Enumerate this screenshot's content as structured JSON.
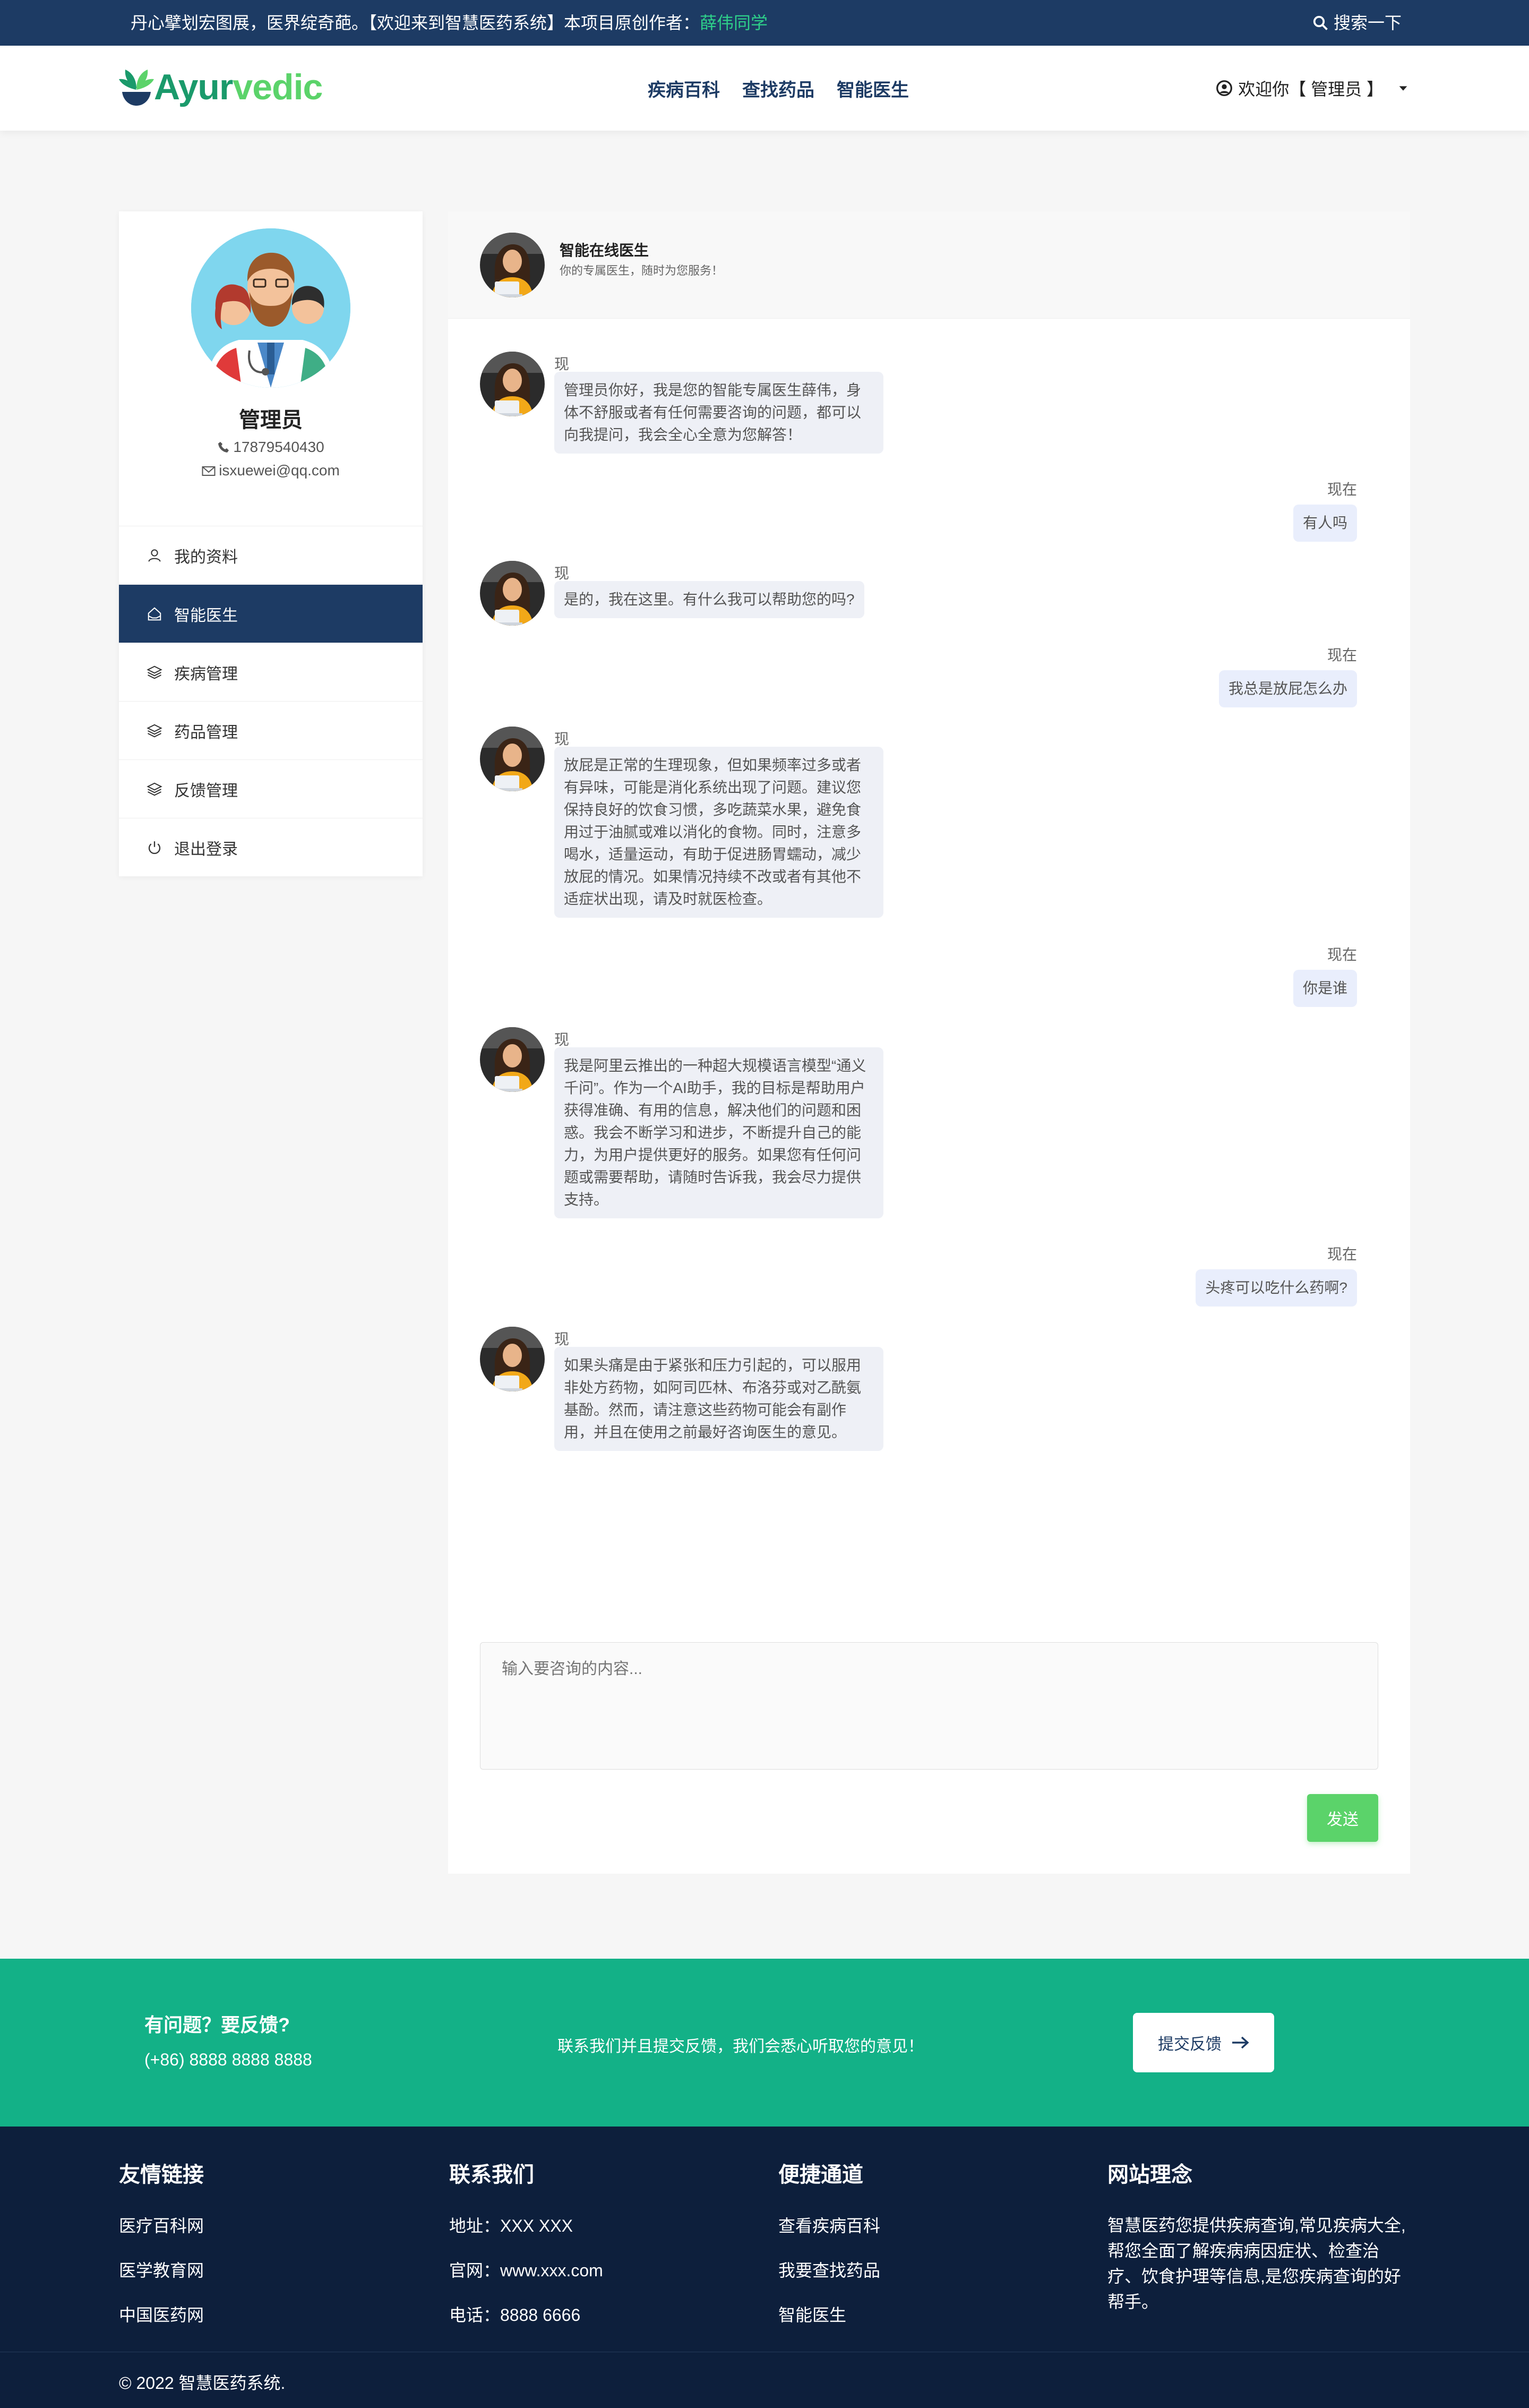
{
  "topbar": {
    "message": "丹心擘划宏图展，医界绽奇葩。【欢迎来到智慧医药系统】本项目原创作者：",
    "author": "薛伟同学",
    "search_label": "搜索一下"
  },
  "nav": {
    "logo_a": "Ayur",
    "logo_b": "vedic",
    "links": [
      "疾病百科",
      "查找药品",
      "智能医生"
    ],
    "user_label": "欢迎你【 管理员 】"
  },
  "profile": {
    "name": "管理员",
    "phone": "17879540430",
    "email": "isxuewei@qq.com"
  },
  "menu": [
    {
      "label": "我的资料",
      "icon": "user-icon"
    },
    {
      "label": "智能医生",
      "icon": "home-icon"
    },
    {
      "label": "疾病管理",
      "icon": "layers-icon"
    },
    {
      "label": "药品管理",
      "icon": "layers-icon"
    },
    {
      "label": "反馈管理",
      "icon": "layers-icon"
    },
    {
      "label": "退出登录",
      "icon": "power-icon"
    }
  ],
  "chat": {
    "title": "智能在线医生",
    "subtitle": "你的专属医生，随时为您服务！",
    "messages": [
      {
        "side": "left",
        "time": "现在",
        "text": "管理员你好，我是您的智能专属医生薛伟，身体不舒服或者有任何需要咨询的问题，都可以向我提问，我会全心全意为您解答！"
      },
      {
        "side": "right",
        "time": "现在",
        "text": "有人吗"
      },
      {
        "side": "left",
        "time": "现在",
        "text": "是的，我在这里。有什么我可以帮助您的吗?"
      },
      {
        "side": "right",
        "time": "现在",
        "text": "我总是放屁怎么办"
      },
      {
        "side": "left",
        "time": "现在",
        "text": "放屁是正常的生理现象，但如果频率过多或者有异味，可能是消化系统出现了问题。建议您保持良好的饮食习惯，多吃蔬菜水果，避免食用过于油腻或难以消化的食物。同时，注意多喝水，适量运动，有助于促进肠胃蠕动，减少放屁的情况。如果情况持续不改或者有其他不适症状出现，请及时就医检查。"
      },
      {
        "side": "right",
        "time": "现在",
        "text": "你是谁"
      },
      {
        "side": "left",
        "time": "现在",
        "text": "我是阿里云推出的一种超大规模语言模型“通义千问”。作为一个AI助手，我的目标是帮助用户获得准确、有用的信息，解决他们的问题和困惑。我会不断学习和进步，不断提升自己的能力，为用户提供更好的服务。如果您有任何问题或需要帮助，请随时告诉我，我会尽力提供支持。"
      },
      {
        "side": "right",
        "time": "现在",
        "text": "头疼可以吃什么药啊?"
      },
      {
        "side": "left",
        "time": "现在",
        "text": "如果头痛是由于紧张和压力引起的，可以服用非处方药物，如阿司匹林、布洛芬或对乙酰氨基酚。然而，请注意这些药物可能会有副作用，并且在使用之前最好咨询医生的意见。"
      }
    ],
    "input_placeholder": "输入要咨询的内容...",
    "send_label": "发送"
  },
  "cta": {
    "question": "有问题？要反馈?",
    "phone": "(+86) 8888 8888 8888",
    "middle": "联系我们并且提交反馈，我们会悉心听取您的意见！",
    "button": "提交反馈"
  },
  "footer": {
    "cols": [
      {
        "title": "友情链接",
        "items": [
          "医疗百科网",
          "医学教育网",
          "中国医药网"
        ]
      },
      {
        "title": "联系我们",
        "items": [
          "地址：XXX XXX",
          "官网：www.xxx.com",
          "电话：8888 6666"
        ]
      },
      {
        "title": "便捷通道",
        "items": [
          "查看疾病百科",
          "我要查找药品",
          "智能医生"
        ]
      }
    ],
    "about_title": "网站理念",
    "about_text": "智慧医药您提供疾病查询,常见疾病大全,帮您全面了解疾病病因症状、检查治疗、饮食护理等信息,是您疾病查询的好帮手。",
    "copyright": "© 2022 智慧医药系统."
  },
  "colors": {
    "navy": "#1d3b64",
    "green": "#13b187",
    "accent": "#5bd36a",
    "footer": "#0d1f3c"
  }
}
